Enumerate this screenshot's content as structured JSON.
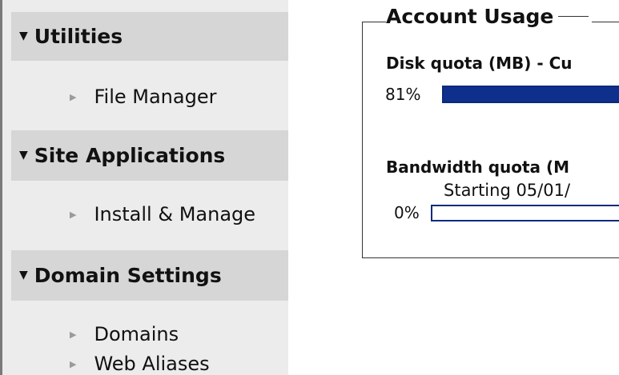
{
  "sidebar": {
    "sections": [
      {
        "title": "Utilities",
        "items": [
          "File Manager"
        ]
      },
      {
        "title": "Site Applications",
        "items": [
          "Install & Manage"
        ]
      },
      {
        "title": "Domain Settings",
        "items": [
          "Domains",
          "Web Aliases"
        ]
      }
    ],
    "expanded_icon": "triangle-down-icon",
    "item_icon": "triangle-right-icon"
  },
  "account_usage": {
    "title": "Account Usage",
    "disk": {
      "label": "Disk quota (MB) - Cu",
      "percent_text": "81%",
      "fill_fraction": 1.0
    },
    "bandwidth": {
      "label": "Bandwidth quota (M",
      "starting": "Starting 05/01/",
      "percent_text": "0%",
      "fill_fraction": 0.0
    }
  },
  "colors": {
    "sidebar_bg": "#ececec",
    "section_header_bg": "#d6d6d6",
    "bar_fill": "#0f2f8c",
    "bar_border": "#0a2a7a"
  }
}
